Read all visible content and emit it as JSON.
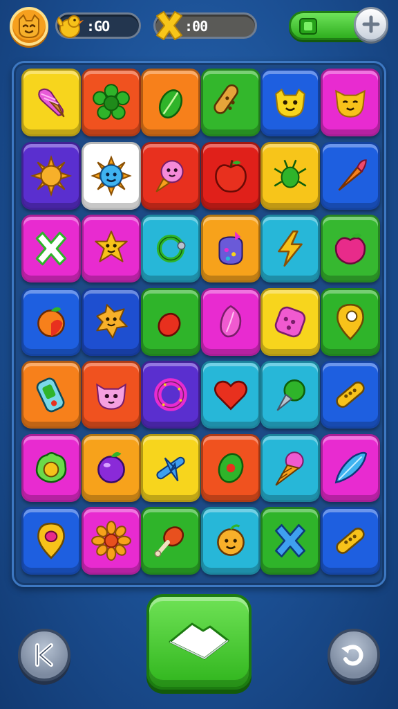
{
  "hud": {
    "coins_value": ":GO",
    "moves_value": ":00",
    "avatar_icon": "cat-face-icon",
    "coins_icon": "chick-icon",
    "moves_icon": "yellow-x-icon",
    "energy_icon": "green-battery-icon",
    "plus_icon": "plus-icon"
  },
  "board": {
    "rows": [
      [
        {
          "bg": "#f7d51d",
          "icon": "pink-ice-cream-icon"
        },
        {
          "bg": "#f0521f",
          "icon": "green-flower-icon"
        },
        {
          "bg": "#f7801b",
          "icon": "green-leaf-icon"
        },
        {
          "bg": "#33b72c",
          "icon": "peanut-icon"
        },
        {
          "bg": "#1e5fe0",
          "icon": "yellow-smiley-icon"
        },
        {
          "bg": "#e82bd0",
          "icon": "yellow-cat-icon"
        }
      ],
      [
        {
          "bg": "#5a2fcf",
          "icon": "sun-icon"
        },
        {
          "bg": "#ffffff",
          "icon": "blue-sun-face-icon"
        },
        {
          "bg": "#e8301e",
          "icon": "pink-fish-icon"
        },
        {
          "bg": "#e0201a",
          "icon": "red-apple-icon"
        },
        {
          "bg": "#f7c51a",
          "icon": "green-bug-icon"
        },
        {
          "bg": "#1e5fe0",
          "icon": "carrot-icon"
        }
      ],
      [
        {
          "bg": "#e82bd0",
          "icon": "white-x-icon"
        },
        {
          "bg": "#e82bd0",
          "icon": "yellow-star-face-icon"
        },
        {
          "bg": "#27b7d8",
          "icon": "green-ring-icon"
        },
        {
          "bg": "#f7a21b",
          "icon": "candy-jar-icon"
        },
        {
          "bg": "#27b7d8",
          "icon": "lightning-icon"
        },
        {
          "bg": "#36b830",
          "icon": "pink-apple-icon"
        }
      ],
      [
        {
          "bg": "#1e5fe0",
          "icon": "peach-icon"
        },
        {
          "bg": "#1e4fd0",
          "icon": "yellow-cookie-icon"
        },
        {
          "bg": "#2fb42a",
          "icon": "red-pepper-icon"
        },
        {
          "bg": "#e82bd0",
          "icon": "pink-berry-icon"
        },
        {
          "bg": "#f7d51d",
          "icon": "pink-dice-icon"
        },
        {
          "bg": "#2fb42a",
          "icon": "pin-icon"
        }
      ],
      [
        {
          "bg": "#f7801b",
          "icon": "phone-icon"
        },
        {
          "bg": "#f0521f",
          "icon": "pink-cat-icon"
        },
        {
          "bg": "#5a2fcf",
          "icon": "donut-icon"
        },
        {
          "bg": "#27b7d8",
          "icon": "heart-icon"
        },
        {
          "bg": "#27b7d8",
          "icon": "green-cone-icon"
        },
        {
          "bg": "#1e5fe0",
          "icon": "cracker-icon"
        }
      ],
      [
        {
          "bg": "#e82bd0",
          "icon": "lettuce-icon"
        },
        {
          "bg": "#f7a21b",
          "icon": "plum-icon"
        },
        {
          "bg": "#f7d51d",
          "icon": "airplane-icon"
        },
        {
          "bg": "#f0521f",
          "icon": "olive-icon"
        },
        {
          "bg": "#27b7d8",
          "icon": "ice-cream-cone-icon"
        },
        {
          "bg": "#e82bd0",
          "icon": "blue-feather-icon"
        }
      ],
      [
        {
          "bg": "#1e5fe0",
          "icon": "location-pin-icon"
        },
        {
          "bg": "#e82bd0",
          "icon": "orange-flower-icon"
        },
        {
          "bg": "#2fb42a",
          "icon": "drumstick-icon"
        },
        {
          "bg": "#27b7d8",
          "icon": "orange-smiley-icon"
        },
        {
          "bg": "#2fb42a",
          "icon": "blue-x-icon"
        },
        {
          "bg": "#1e5fe0",
          "icon": "cracker-icon"
        }
      ]
    ]
  },
  "controls": {
    "back_icon": "back-k-icon",
    "play_icon": "white-book-icon",
    "undo_icon": "undo-icon"
  }
}
